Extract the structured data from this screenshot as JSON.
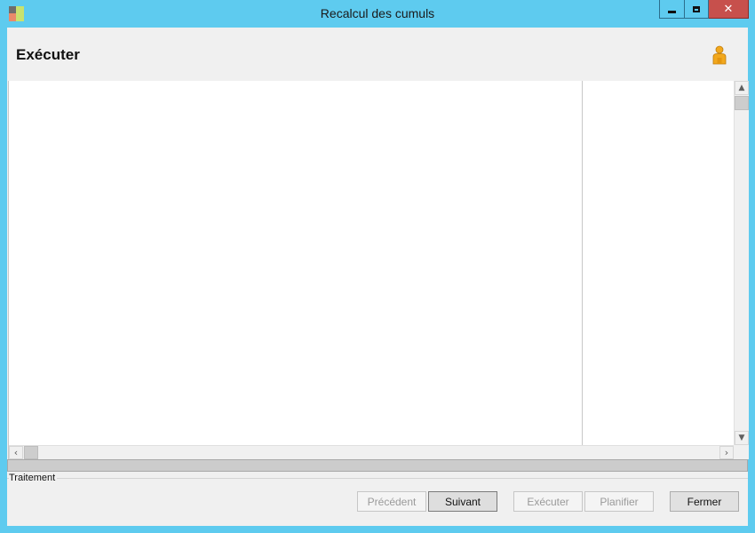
{
  "window": {
    "title": "Recalcul des cumuls",
    "controls": {
      "minimize": "minimize-icon",
      "maximize": "maximize-icon",
      "close": "close-icon"
    }
  },
  "header": {
    "title": "Exécuter",
    "user_icon": "user-icon"
  },
  "progress": {
    "value": 0
  },
  "group": {
    "label": "Traitement"
  },
  "buttons": {
    "previous": {
      "label": "Précédent",
      "enabled": false
    },
    "next": {
      "label": "Suivant",
      "enabled": true
    },
    "execute": {
      "label": "Exécuter",
      "enabled": false
    },
    "schedule": {
      "label": "Planifier",
      "enabled": false
    },
    "close": {
      "label": "Fermer",
      "enabled": true
    }
  },
  "colors": {
    "window_frame": "#5ecbef",
    "close_button": "#c7504c",
    "client_background": "#f0f0f0"
  }
}
